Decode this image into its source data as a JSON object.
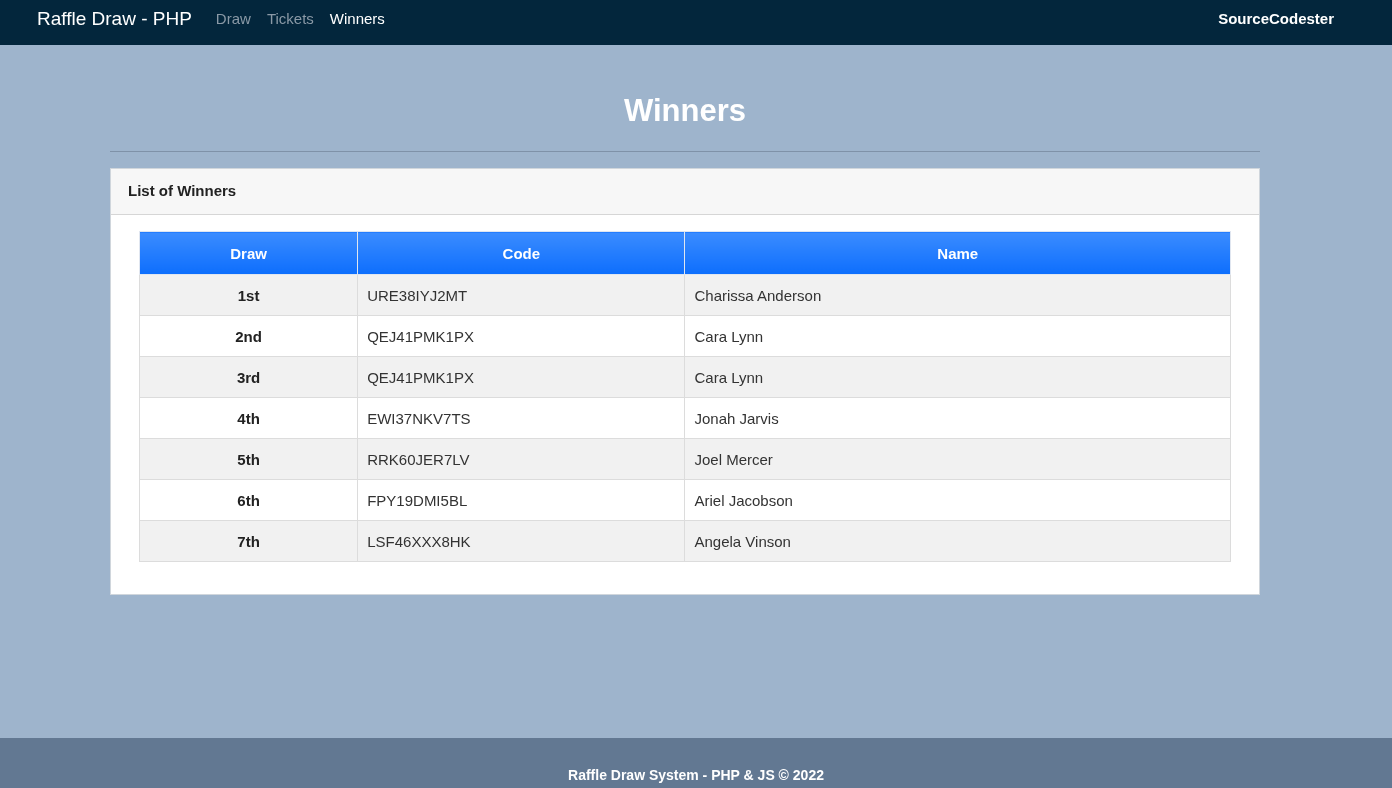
{
  "navbar": {
    "brand": "Raffle Draw - PHP",
    "links": [
      {
        "label": "Draw",
        "selected": false
      },
      {
        "label": "Tickets",
        "selected": false
      },
      {
        "label": "Winners",
        "selected": true
      }
    ],
    "right_text": "SourceCodester"
  },
  "page_title": "Winners",
  "card": {
    "title": "List of Winners",
    "table": {
      "columns": [
        "Draw",
        "Code",
        "Name"
      ],
      "rows": [
        [
          "1st",
          "URE38IYJ2MT",
          "Charissa Anderson"
        ],
        [
          "2nd",
          "QEJ41PMK1PX",
          "Cara Lynn"
        ],
        [
          "3rd",
          "QEJ41PMK1PX",
          "Cara Lynn"
        ],
        [
          "4th",
          "EWI37NKV7TS",
          "Jonah Jarvis"
        ],
        [
          "5th",
          "RRK60JER7LV",
          "Joel Mercer"
        ],
        [
          "6th",
          "FPY19DMI5BL",
          "Ariel Jacobson"
        ],
        [
          "7th",
          "LSF46XXX8HK",
          "Angela Vinson"
        ]
      ]
    }
  },
  "footer": "Raffle Draw System - PHP & JS © 2022"
}
